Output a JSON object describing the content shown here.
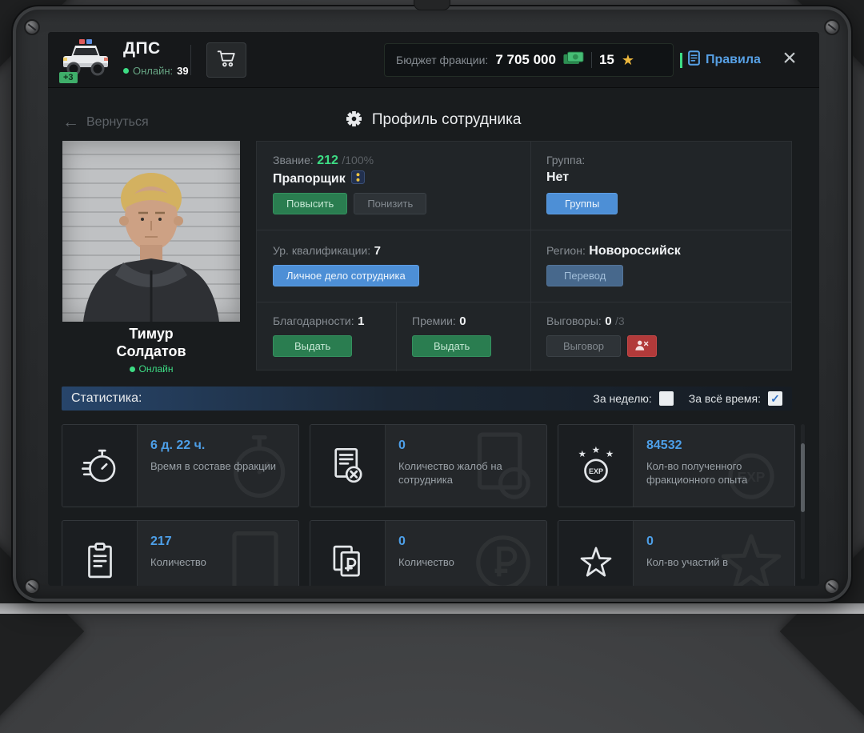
{
  "icons": {
    "star": "★",
    "check": "✓",
    "close": "×",
    "back_arrow": "←"
  },
  "header": {
    "faction": "ДПС",
    "online_label": "Онлайн:",
    "online_value": "39",
    "members_badge": "+3",
    "budget_label": "Бюджет фракции:",
    "budget_value": "7 705 000",
    "stars_value": "15",
    "rules": "Правила"
  },
  "subheader": {
    "back": "Вернуться",
    "title": "Профиль сотрудника"
  },
  "profile": {
    "first_name": "Тимур",
    "last_name": "Солдатов",
    "online_status": "Онлайн"
  },
  "info": {
    "rank_label": "Звание:",
    "rank_points": "212",
    "rank_percent": "/100%",
    "rank_name": "Прапорщик",
    "promote": "Повысить",
    "demote": "Понизить",
    "group_label": "Группа:",
    "group_value": "Нет",
    "groups_btn": "Группы",
    "qual_label": "Ур. квалификации:",
    "qual_value": "7",
    "personal_file_btn": "Личное дело сотрудника",
    "region_label": "Регион:",
    "region_value": "Новороссийск",
    "transfer_btn": "Перевод",
    "thanks_label": "Благодарности:",
    "thanks_value": "1",
    "thanks_btn": "Выдать",
    "bonus_label": "Премии:",
    "bonus_value": "0",
    "bonus_btn": "Выдать",
    "reprimand_label": "Выговоры:",
    "reprimand_value": "0",
    "reprimand_max": "/3",
    "reprimand_btn": "Выговор"
  },
  "stats": {
    "title": "Статистика:",
    "week_label": "За неделю:",
    "alltime_label": "За всё время:",
    "cards": [
      {
        "icon": "stopwatch-icon",
        "value": "6 д. 22 ч.",
        "label": "Время в составе фракции"
      },
      {
        "icon": "complaints-icon",
        "value": "0",
        "label": "Количество жалоб на сотрудника"
      },
      {
        "icon": "exp-icon",
        "value": "84532",
        "label": "Кол-во полученного фракционного опыта"
      },
      {
        "icon": "tasks-icon",
        "value": "217",
        "label": "Количество"
      },
      {
        "icon": "salary-icon",
        "value": "0",
        "label": "Количество"
      },
      {
        "icon": "events-icon",
        "value": "0",
        "label": "Кол-во участий в"
      }
    ]
  }
}
